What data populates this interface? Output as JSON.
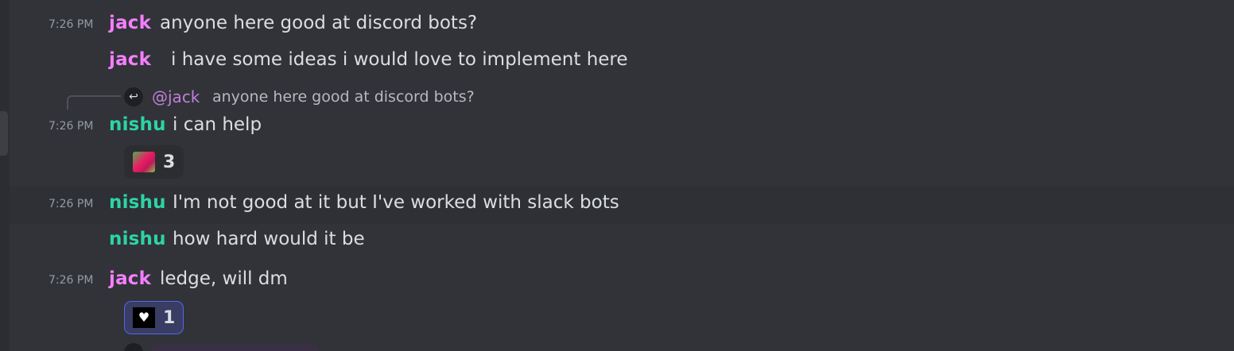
{
  "colors": {
    "background": "#313338",
    "jack": "#f47fff",
    "nishu": "#2dd4a4",
    "reaction_active_border": "#5865f2"
  },
  "messages": [
    {
      "time": "7:26 PM",
      "author": "jack",
      "text": "anyone here good at discord bots?"
    },
    {
      "author": "jack",
      "text": "i have some ideas i would love to implement here"
    },
    {
      "reply_mention": "@jack",
      "reply_preview": "anyone here good at discord bots?",
      "time": "7:26 PM",
      "author": "nishu",
      "text": "i can help",
      "reaction": {
        "emoji": "custom-emoji-image",
        "count": "3"
      }
    },
    {
      "time": "7:26 PM",
      "author": "nishu",
      "text": "I'm not good at it but I've worked with slack bots"
    },
    {
      "author": "nishu",
      "text": "how hard would it be"
    },
    {
      "time": "7:26 PM",
      "author": "jack",
      "text": "ledge, will dm",
      "reaction": {
        "emoji": "heart-emoji",
        "count": "1"
      }
    }
  ]
}
